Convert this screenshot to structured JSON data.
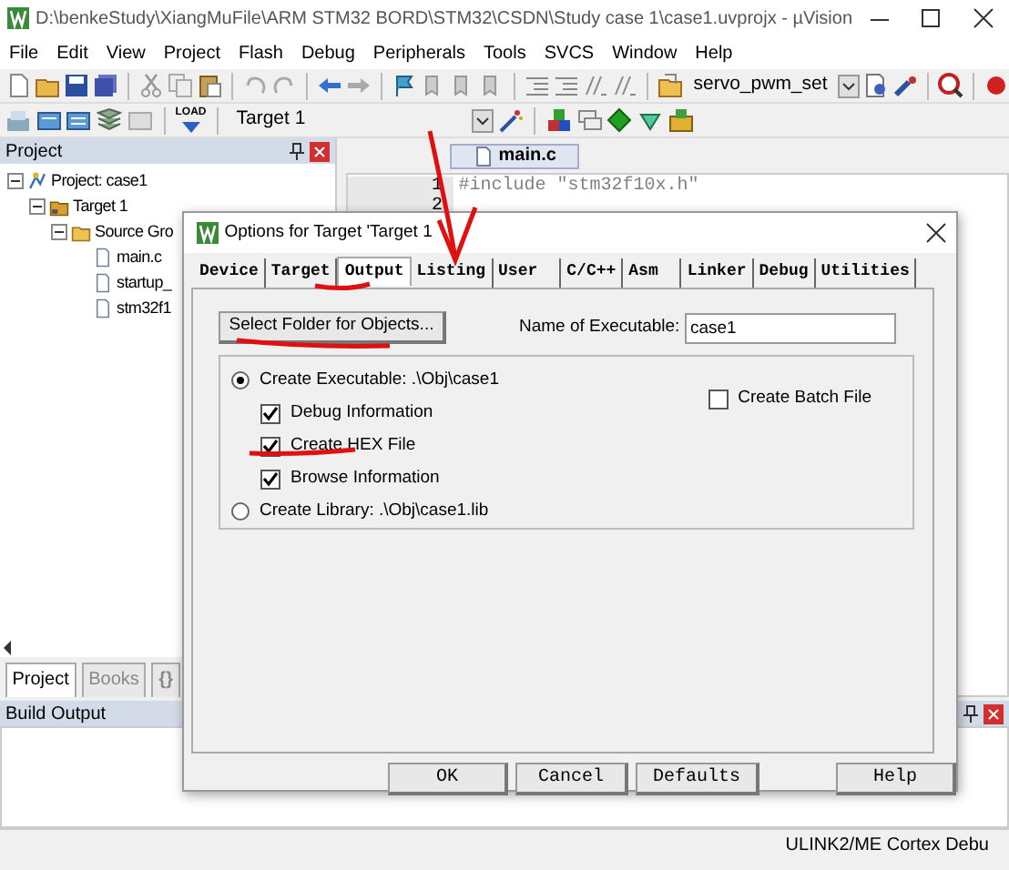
{
  "window": {
    "title": "D:\\benkeStudy\\XiangMuFile\\ARM STM32 BORD\\STM32\\CSDN\\Study case 1\\case1.uvprojx - µVision"
  },
  "menu": [
    "File",
    "Edit",
    "View",
    "Project",
    "Flash",
    "Debug",
    "Peripherals",
    "Tools",
    "SVCS",
    "Window",
    "Help"
  ],
  "toolbar": {
    "find_select": "servo_pwm_set",
    "load_label": "LOAD",
    "target_select": "Target 1"
  },
  "project_panel": {
    "title": "Project",
    "tree": [
      {
        "label": "Project: case1",
        "kind": "project",
        "expanded": true,
        "children": [
          {
            "label": "Target 1",
            "kind": "target",
            "expanded": true,
            "children": [
              {
                "label": "Source Gro",
                "kind": "folder",
                "expanded": true,
                "children": [
                  {
                    "label": "main.c",
                    "kind": "file"
                  },
                  {
                    "label": "startup_",
                    "kind": "file"
                  },
                  {
                    "label": "stm32f1",
                    "kind": "file"
                  }
                ]
              }
            ]
          }
        ]
      }
    ],
    "tabs": [
      {
        "label": "Project",
        "selected": true
      },
      {
        "label": "Books",
        "selected": false
      },
      {
        "label": "{}",
        "selected": false
      }
    ]
  },
  "editor": {
    "tab": "main.c",
    "lines": [
      {
        "number": "1",
        "code": "#include \"stm32f10x.h\""
      },
      {
        "number": "2"
      }
    ]
  },
  "build_output": {
    "title": "Build Output"
  },
  "status_bar": {
    "debugger": "ULINK2/ME Cortex Debu"
  },
  "dialog": {
    "title": "Options for Target 'Target 1",
    "tabs": [
      {
        "label": "Device",
        "selected": false
      },
      {
        "label": "Target",
        "selected": false
      },
      {
        "label": "Output",
        "selected": true
      },
      {
        "label": "Listing",
        "selected": false
      },
      {
        "label": "User",
        "selected": false
      },
      {
        "label": "C/C++",
        "selected": false
      },
      {
        "label": "Asm",
        "selected": false
      },
      {
        "label": "Linker",
        "selected": false
      },
      {
        "label": "Debug",
        "selected": false
      },
      {
        "label": "Utilities",
        "selected": false
      }
    ],
    "select_folder_button": "Select Folder for Objects...",
    "name_label": "Name of Executable:",
    "name_value": "case1",
    "executable": {
      "label": "Create Executable:  .\\Obj\\case1",
      "selected": true
    },
    "executable_options": [
      {
        "label": "Debug Information",
        "checked": true
      },
      {
        "label": "Create HEX File",
        "checked": true
      },
      {
        "label": "Browse Information",
        "checked": true
      }
    ],
    "batch_file": {
      "label": "Create Batch File",
      "checked": false
    },
    "library": {
      "label": "Create Library:  .\\Obj\\case1.lib",
      "selected": false
    },
    "buttons": [
      "OK",
      "Cancel",
      "Defaults",
      "Help"
    ]
  }
}
